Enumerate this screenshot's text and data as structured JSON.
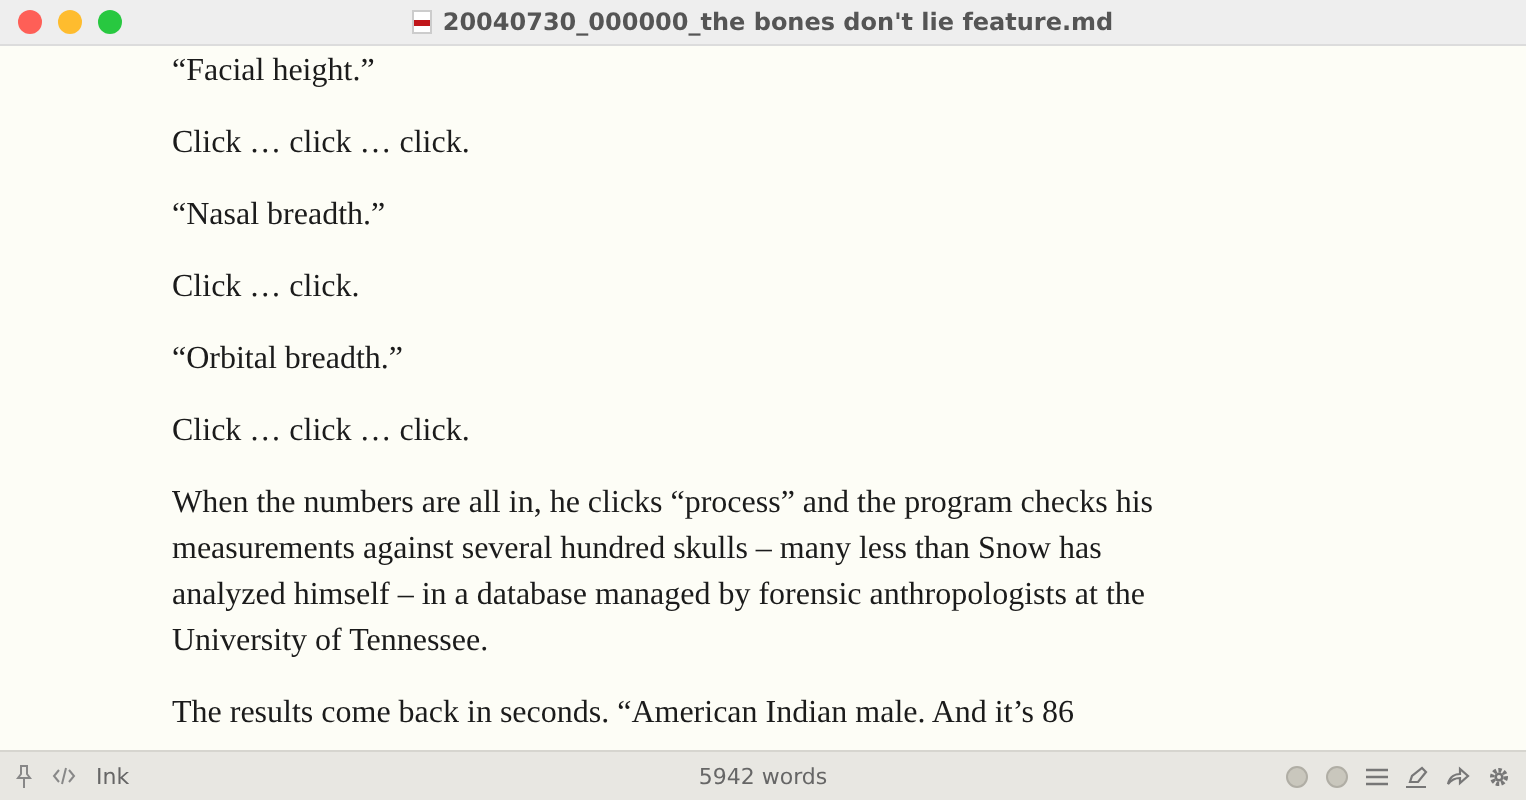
{
  "window": {
    "title": "20040730_000000_the bones don't lie feature.md"
  },
  "paragraphs": [
    "“Facial height.”",
    "Click … click … click.",
    "“Nasal breadth.”",
    "Click … click.",
    "“Orbital breadth.”",
    "Click … click … click.",
    "When the numbers are all in, he clicks “process” and the program checks his measurements against several hundred skulls – many less than Snow has analyzed himself – in a database managed by forensic anthropologists at the University of Tennessee.",
    "The results come back in seconds. “American Indian male. And it’s 86"
  ],
  "status_bar": {
    "theme": "Ink",
    "word_count": "5942 words"
  }
}
